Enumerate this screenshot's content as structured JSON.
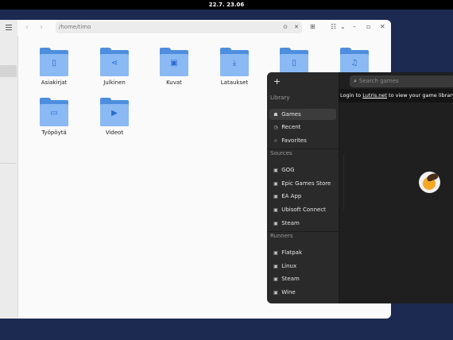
{
  "topbar": {
    "clock": "22.7.  23.06"
  },
  "files": {
    "path": "/home/timo",
    "nav_back": "‹",
    "nav_forward": "›",
    "folders": [
      {
        "label": "Asiakirjat",
        "icon": "document-icon",
        "glyph": "▯"
      },
      {
        "label": "Julkinen",
        "icon": "share-icon",
        "glyph": "⋖"
      },
      {
        "label": "Kuvat",
        "icon": "image-icon",
        "glyph": "▣"
      },
      {
        "label": "Lataukset",
        "icon": "download-icon",
        "glyph": "⤓"
      },
      {
        "label": "",
        "icon": "document-icon",
        "glyph": "▯"
      },
      {
        "label": "",
        "icon": "music-icon",
        "glyph": "♫"
      },
      {
        "label": "Työpöytä",
        "icon": "desktop-icon",
        "glyph": "▭"
      },
      {
        "label": "Videot",
        "icon": "video-icon",
        "glyph": "▶"
      }
    ]
  },
  "lutris": {
    "add_label": "+",
    "search_placeholder": "Search games",
    "login_prefix": "Login to ",
    "login_link": "Lutris.net",
    "login_suffix": " to view your game library",
    "library_title": "Library",
    "library_items": [
      {
        "label": "Games",
        "icon": "gamepad-icon",
        "glyph": "☗"
      },
      {
        "label": "Recent",
        "icon": "clock-icon",
        "glyph": "◷"
      },
      {
        "label": "Favorites",
        "icon": "star-icon",
        "glyph": "☆"
      }
    ],
    "sources_title": "Sources",
    "source_items": [
      {
        "label": "GOG",
        "icon": "gog-icon",
        "glyph": "▣"
      },
      {
        "label": "Epic Games Store",
        "icon": "epic-icon",
        "glyph": "▣"
      },
      {
        "label": "EA App",
        "icon": "ea-icon",
        "glyph": "▣"
      },
      {
        "label": "Ubisoft Connect",
        "icon": "ubisoft-icon",
        "glyph": "▣"
      },
      {
        "label": "Steam",
        "icon": "steam-icon",
        "glyph": "▣"
      }
    ],
    "runners_title": "Runners",
    "runner_items": [
      {
        "label": "Flatpak",
        "icon": "flatpak-icon",
        "glyph": "▣"
      },
      {
        "label": "Linux",
        "icon": "linux-icon",
        "glyph": "▣"
      },
      {
        "label": "Steam",
        "icon": "steam-runner-icon",
        "glyph": "▣"
      },
      {
        "label": "Wine",
        "icon": "wine-icon",
        "glyph": "▣"
      }
    ]
  }
}
